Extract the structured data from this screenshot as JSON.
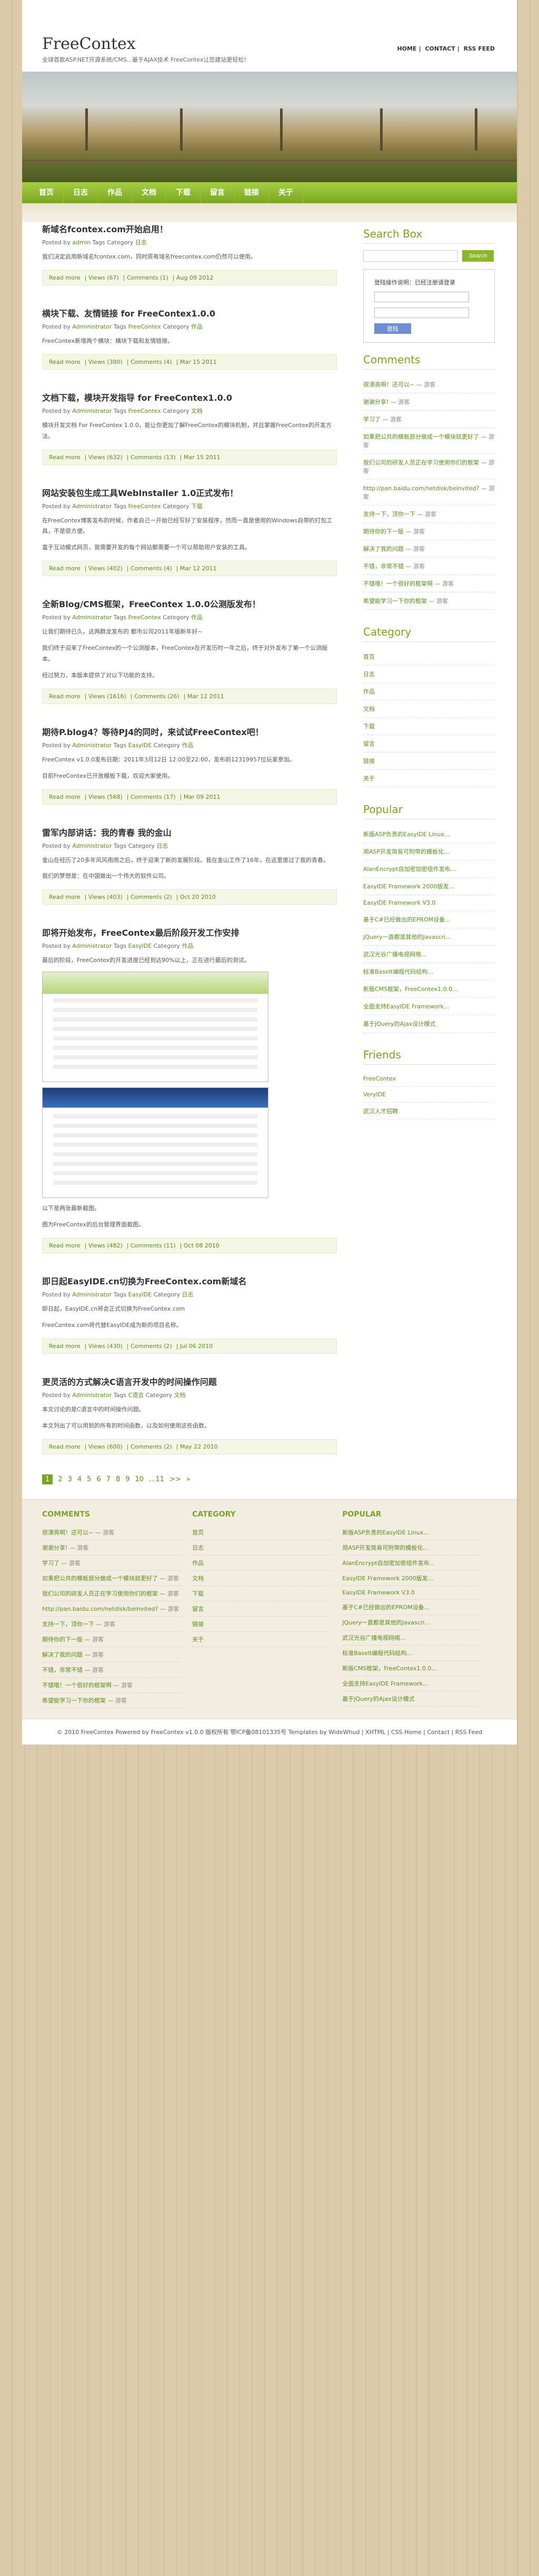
{
  "site": {
    "title": "FreeContex",
    "description": "全球首款ASP.NET开源系统/CMS...基于AJAX技术  FreeContex让您建站更轻松!",
    "top_links": [
      "HOME",
      "CONTACT",
      "RSS FEED"
    ]
  },
  "nav": [
    "首页",
    "日志",
    "作品",
    "文档",
    "下载",
    "留言",
    "链接",
    "关于"
  ],
  "posts": [
    {
      "title": "新域名fcontex.com开始启用！",
      "meta": {
        "posted_by_label": "Posted by",
        "author": "admin",
        "tags_label": "Tags",
        "category_label": "Category",
        "category": "日志"
      },
      "paragraphs": [
        "我们决定启用新域名fcontex.com，同时原有域名freecontex.com仍然可以使用。"
      ],
      "foot": {
        "read_more": "Read more",
        "views": "Views (67)",
        "comments": "Comments (1)",
        "date": "Aug 09 2012"
      }
    },
    {
      "title": "横块下载、友情链接 for FreeContex1.0.0",
      "meta": {
        "posted_by_label": "Posted by",
        "author": "Administrator",
        "tags_label": "Tags",
        "tags": "FreeContex",
        "category_label": "Category",
        "category": "作品"
      },
      "paragraphs": [
        "FreeContex新增两个横块：横块下载和友情链接。"
      ],
      "foot": {
        "read_more": "Read more",
        "views": "Views (380)",
        "comments": "Comments (4)",
        "date": "Mar 15 2011"
      }
    },
    {
      "title": "文档下载，模块开发指导 for FreeContex1.0.0",
      "meta": {
        "posted_by_label": "Posted by",
        "author": "Administrator",
        "tags_label": "Tags",
        "tags": "FreeContex",
        "category_label": "Category",
        "category": "文档"
      },
      "paragraphs": [
        "模块开发文档 For FreeContex 1.0.0，能让你更加了解FreeContex的模块机制，并且掌握FreeContex的开发方法。"
      ],
      "foot": {
        "read_more": "Read more",
        "views": "Views (632)",
        "comments": "Comments (13)",
        "date": "Mar 15 2011"
      }
    },
    {
      "title": "网站安装包生成工具WebInstaller 1.0正式发布！",
      "meta": {
        "posted_by_label": "Posted by",
        "author": "Administrator",
        "tags_label": "Tags",
        "tags": "FreeContex",
        "category_label": "Category",
        "category": "下载"
      },
      "paragraphs": [
        "在FreeContex博客发布的时候，作者自己一开始已经写好了安装程序，然而一直是使用的Windows自带的打包工具，不是很方便。",
        "富于互动模式网页，我需要开发的每个网站都需要一个可以帮助用户安装的工具。"
      ],
      "foot": {
        "read_more": "Read more",
        "views": "Views (402)",
        "comments": "Comments (4)",
        "date": "Mar 12 2011"
      }
    },
    {
      "title": "全新Blog/CMS框架，FreeContex 1.0.0公测版发布！",
      "meta": {
        "posted_by_label": "Posted by",
        "author": "Administrator",
        "tags_label": "Tags",
        "tags": "FreeContex",
        "category_label": "Category",
        "category": "作品"
      },
      "paragraphs": [
        "让我们期待已久，这两群龙发布的 都市公司2011年版新年好~",
        "我们终于迎来了FreeContex的一个公测版本，FreeContex在开发历时一年之后，终于对外发布了第一个公测版本。",
        "经过努力，本版本提供了对以下功能的支持。"
      ],
      "foot": {
        "read_more": "Read more",
        "views": "Views (1616)",
        "comments": "Comments (26)",
        "date": "Mar 12 2011"
      }
    },
    {
      "title": "期待P.blog4？等待PJ4的同时，来试试FreeContex吧！",
      "meta": {
        "posted_by_label": "Posted by",
        "author": "Administrator",
        "tags_label": "Tags",
        "tags": "EasyIDE",
        "category_label": "Category",
        "category": "作品"
      },
      "paragraphs": [
        "FreeContex v1.0.0发布日期：2011年3月12日 12:00至22:00，发布前12319957位玩家参加。",
        "目前FreeContex已开放模板下载，欢迎大家使用。"
      ],
      "foot": {
        "read_more": "Read more",
        "views": "Views (568)",
        "comments": "Comments (17)",
        "date": "Mar 09 2011"
      }
    },
    {
      "title": "雷军内部讲话：我的青春 我的金山",
      "meta": {
        "posted_by_label": "Posted by",
        "author": "Administrator",
        "tags_label": "Tags",
        "category_label": "Category",
        "category": "日志"
      },
      "paragraphs": [
        "金山在经历了20多年风风雨雨之后，终于迎来了新的发展阶段。我在金山工作了16年，在这里度过了我的青春。",
        "我们的梦想是：在中国做出一个伟大的软件公司。"
      ],
      "foot": {
        "read_more": "Read more",
        "views": "Views (403)",
        "comments": "Comments (2)",
        "date": "Oct 20 2010"
      }
    },
    {
      "title": "即将开始发布，FreeContex最后阶段开发工作安排",
      "meta": {
        "posted_by_label": "Posted by",
        "author": "Administrator",
        "tags_label": "Tags",
        "tags": "EasyIDE",
        "category_label": "Category",
        "category": "作品"
      },
      "paragraphs": [
        "最后的阶段，FreeContex的开发进度已经到达90%以上，正在进行最后的测试。",
        "以下是两张最新截图。",
        "图为FreeContex的后台管理界面截图。"
      ],
      "foot": {
        "read_more": "Read more",
        "views": "Views (482)",
        "comments": "Comments (11)",
        "date": "Oct 08 2010"
      }
    },
    {
      "title": "即日起EasyIDE.cn切换为FreeContex.com新域名",
      "meta": {
        "posted_by_label": "Posted by",
        "author": "Administrator",
        "tags_label": "Tags",
        "tags": "EasyIDE",
        "category_label": "Category",
        "category": "日志"
      },
      "paragraphs": [
        "即日起，EasyIDE.cn将会正式切换为FreeContex.com",
        "FreeContex.com将代替EasyIDE成为新的项目名称。"
      ],
      "foot": {
        "read_more": "Read more",
        "views": "Views (430)",
        "comments": "Comments (2)",
        "date": "Jul 06 2010"
      }
    },
    {
      "title": "更灵活的方式解决C语言开发中的时间操作问题",
      "meta": {
        "posted_by_label": "Posted by",
        "author": "Administrator",
        "tags_label": "Tags",
        "tags": "C语言",
        "category_label": "Category",
        "category": "文档"
      },
      "paragraphs": [
        "本文讨论的是C语言中的时间操作问题。",
        "本文列出了可以用到的所有的时间函数，以及如何使用这些函数。"
      ],
      "foot": {
        "read_more": "Read more",
        "views": "Views (600)",
        "comments": "Comments (2)",
        "date": "May 22 2010"
      }
    }
  ],
  "pager": [
    "1",
    "2",
    "3",
    "4",
    "5",
    "6",
    "7",
    "8",
    "9",
    "10",
    "...11",
    ">>",
    "»"
  ],
  "sidebar": {
    "search_title": "Search Box",
    "search_placeholder": "",
    "search_button": "Search",
    "login_text": "登陆操作说明：已经注册请登录",
    "login_button": "登陆",
    "comments_title": "Comments",
    "comments": [
      {
        "text": "很漂亮啊！还可以~",
        "who": "游客"
      },
      {
        "text": "谢谢分享!",
        "who": "游客"
      },
      {
        "text": "学习了",
        "who": "游客"
      },
      {
        "text": "如果把公共的模板部分做成一个模块就更好了",
        "who": "游客"
      },
      {
        "text": "我们公司的研发人员正在学习使用你们的框架",
        "who": "游客"
      },
      {
        "text": "http://pan.baidu.com/netdisk/beinvited?",
        "who": "游客"
      },
      {
        "text": "支持一下，顶你一下",
        "who": "游客"
      },
      {
        "text": "期待你的下一版",
        "who": "游客"
      },
      {
        "text": "解决了我的问题",
        "who": "游客"
      },
      {
        "text": "不错，非常不错",
        "who": "游客"
      },
      {
        "text": "不错哦！一个很好的框架啊",
        "who": "游客"
      },
      {
        "text": "希望能学习一下你的框架",
        "who": "游客"
      }
    ],
    "category_title": "Category",
    "categories": [
      "首页",
      "日志",
      "作品",
      "文档",
      "下载",
      "留言",
      "链接",
      "关于"
    ],
    "popular_title": "Popular",
    "popular": [
      "新版ASP负责的EasyIDE Linux...",
      "用ASP开发简易可附带的模板化...",
      "AlanEncrypt自加密加密组件发布...",
      "EasyIDE Framework 2000版发...",
      "EasyIDE Framework V3.0",
      "基于C#已经做出的EPROM设备...",
      "JQuery一直都是其他的Javascri...",
      "武汉光谷广播电视网络...",
      "标准BaseIt编程代码结构...",
      "新版CMS框架，FreeContex1.0.0...",
      "全面支持EasyIDE Framework...",
      "基于JQuery的Ajax设计模式"
    ],
    "friends_title": "Friends",
    "friends": [
      "FreeContex",
      "VeryIDE",
      "武汉人才招聘"
    ]
  },
  "footer": {
    "comments_title": "COMMENTS",
    "category_title": "CATEGORY",
    "popular_title": "POPULAR",
    "copyright": "© 2010 FreeContex Powered by FreeContex v1.0.0 版权所有 鄂ICP备08101335号    Templates by WideWhud | XHTML | CSS   Home | Contact | RSS Feed"
  }
}
